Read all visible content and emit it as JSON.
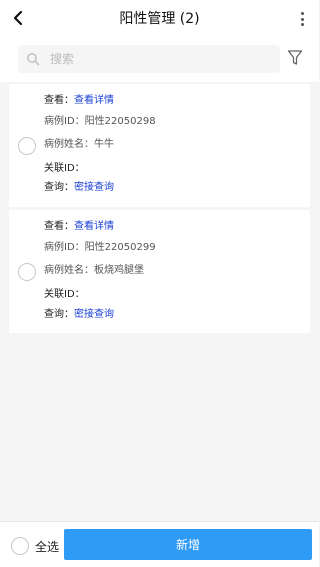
{
  "header": {
    "title": "阳性管理 (2)",
    "back_icon": "chevron-left-icon",
    "more_icon": "more-vertical-icon"
  },
  "search": {
    "placeholder": "搜索",
    "icon": "search-icon",
    "filter_icon": "filter-icon"
  },
  "cards": [
    {
      "view_label": "查看：",
      "view_link": "查看详情",
      "case_id_label": "病例ID：",
      "case_id": "阳性22050298",
      "name_label": "病例姓名：",
      "name": "牛牛",
      "related_label": "关联ID：",
      "related_id": "",
      "query_label": "查询：",
      "query_link": "密接查询"
    },
    {
      "view_label": "查看：",
      "view_link": "查看详情",
      "case_id_label": "病例ID：",
      "case_id": "阳性22050299",
      "name_label": "病例姓名：",
      "name": "板烧鸡腿堡",
      "related_label": "关联ID：",
      "related_id": "",
      "query_label": "查询：",
      "query_link": "密接查询"
    }
  ],
  "footer": {
    "select_all": "全选",
    "add_button": "新增"
  },
  "colors": {
    "link": "#1a3fd4",
    "primary_button": "#2f9bf5"
  }
}
